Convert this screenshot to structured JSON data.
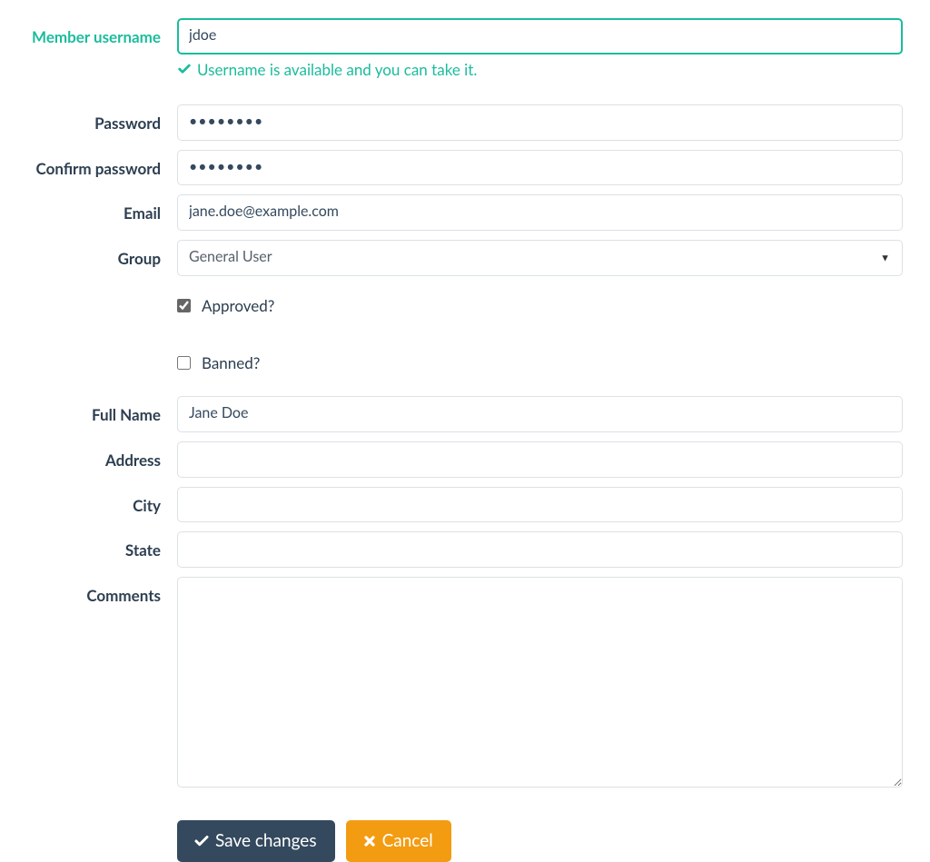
{
  "labels": {
    "username": "Member username",
    "password": "Password",
    "confirm_password": "Confirm password",
    "email": "Email",
    "group": "Group",
    "full_name": "Full Name",
    "address": "Address",
    "city": "City",
    "state": "State",
    "comments": "Comments"
  },
  "values": {
    "username": "jdoe",
    "password": "••••••••",
    "confirm_password": "••••••••",
    "email": "jane.doe@example.com",
    "group": "General User",
    "full_name": "Jane Doe",
    "address": "",
    "city": "",
    "state": "",
    "comments": ""
  },
  "help": {
    "username_available": "Username is available and you can take it."
  },
  "checkboxes": {
    "approved_label": "Approved?",
    "approved_checked": true,
    "banned_label": "Banned?",
    "banned_checked": false
  },
  "select_options": {
    "group": [
      "General User"
    ]
  },
  "buttons": {
    "save": "Save changes",
    "cancel": "Cancel"
  }
}
